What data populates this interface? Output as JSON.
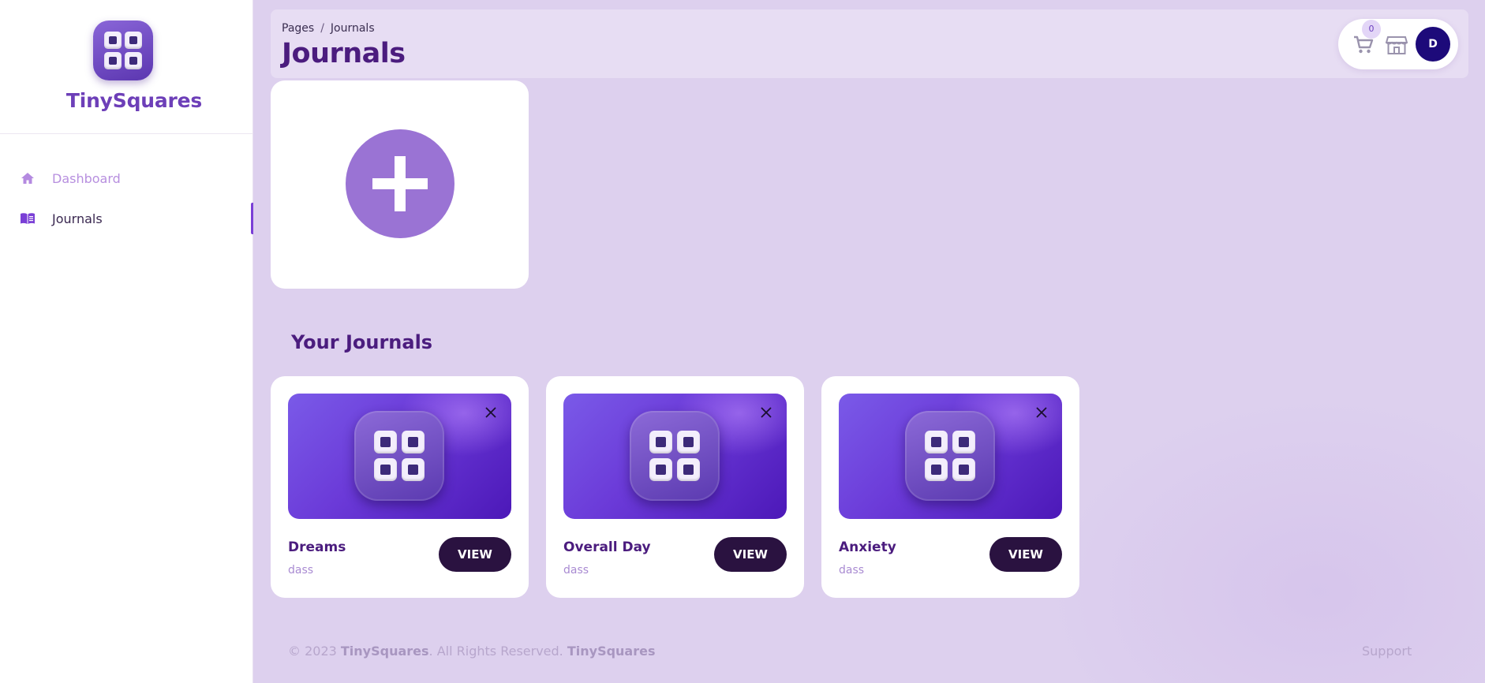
{
  "app": {
    "brand": "TinySquares"
  },
  "sidebar": {
    "items": [
      {
        "label": "Dashboard",
        "icon": "home-icon",
        "active": false
      },
      {
        "label": "Journals",
        "icon": "book-icon",
        "active": true
      }
    ]
  },
  "header": {
    "breadcrumb": {
      "root": "Pages",
      "separator": "/",
      "current": "Journals"
    },
    "title": "Journals",
    "cart_count": "0",
    "avatar_initial": "D"
  },
  "main": {
    "section_title": "Your Journals",
    "journals": [
      {
        "name": "Dreams",
        "subtitle": "dass",
        "view_label": "VIEW"
      },
      {
        "name": "Overall Day",
        "subtitle": "dass",
        "view_label": "VIEW"
      },
      {
        "name": "Anxiety",
        "subtitle": "dass",
        "view_label": "VIEW"
      }
    ]
  },
  "footer": {
    "copyright_prefix": "© 2023 ",
    "brand_1": "TinySquares",
    "rights": ". All Rights Reserved. ",
    "brand_2": "TinySquares",
    "support": "Support"
  },
  "colors": {
    "accent": "#7a3fd6",
    "title": "#4b1c7e",
    "background": "#ddd0ee",
    "button": "#2a1240"
  }
}
